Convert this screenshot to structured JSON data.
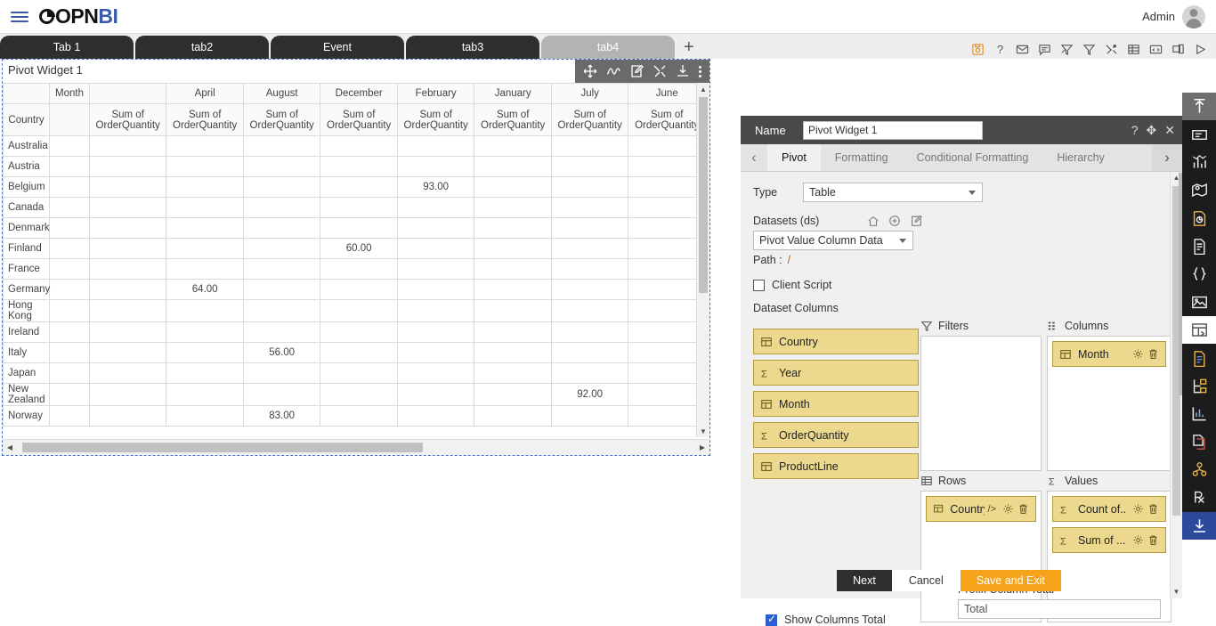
{
  "app": {
    "logo_opn": "OPN",
    "logo_bi": "BI",
    "user_label": "Admin"
  },
  "tabs": {
    "items": [
      {
        "label": "Tab 1",
        "active": false
      },
      {
        "label": "tab2",
        "active": false
      },
      {
        "label": "Event",
        "active": false
      },
      {
        "label": "tab3",
        "active": false
      },
      {
        "label": "tab4",
        "active": true
      }
    ],
    "add_label": "+"
  },
  "tabbar_icons": [
    {
      "name": "save-icon",
      "title": "Save"
    },
    {
      "name": "help-icon",
      "title": "Help"
    },
    {
      "name": "mail-icon",
      "title": "Mail"
    },
    {
      "name": "comment-icon",
      "title": "Comment"
    },
    {
      "name": "clear-filter-icon",
      "title": "Clear Filter"
    },
    {
      "name": "filter-icon",
      "title": "Filter"
    },
    {
      "name": "tools-icon",
      "title": "Tools"
    },
    {
      "name": "table-icon",
      "title": "Table"
    },
    {
      "name": "code-icon",
      "title": "Code"
    },
    {
      "name": "copy-icon",
      "title": "Copy"
    },
    {
      "name": "play-icon",
      "title": "Run"
    }
  ],
  "widget": {
    "title": "Pivot Widget 1",
    "tools": [
      {
        "name": "move-icon",
        "title": "Move"
      },
      {
        "name": "chart-icon",
        "title": "Chart"
      },
      {
        "name": "edit-icon",
        "title": "Edit"
      },
      {
        "name": "settings-tools-icon",
        "title": "Tools"
      },
      {
        "name": "download-icon",
        "title": "Download"
      },
      {
        "name": "more-options-icon",
        "title": "More"
      }
    ]
  },
  "chart_data": {
    "type": "table",
    "title": "Pivot Widget 1",
    "corner_row_label": "Country",
    "corner_col_label": "Month",
    "measure_label": "Sum of OrderQuantity",
    "categories": [
      "",
      "April",
      "August",
      "December",
      "February",
      "January",
      "July",
      "June"
    ],
    "row_labels": [
      "Australia",
      "Austria",
      "Belgium",
      "Canada",
      "Denmark",
      "Finland",
      "France",
      "Germany",
      "Hong Kong",
      "Ireland",
      "Italy",
      "Japan",
      "New Zealand",
      "Norway"
    ],
    "rows": [
      {
        "country": "Australia",
        "values": [
          "",
          "",
          "",
          "",
          "",
          "",
          "",
          ""
        ]
      },
      {
        "country": "Austria",
        "values": [
          "",
          "",
          "",
          "",
          "",
          "",
          "",
          ""
        ]
      },
      {
        "country": "Belgium",
        "values": [
          "",
          "",
          "",
          "",
          "93.00",
          "",
          "",
          ""
        ]
      },
      {
        "country": "Canada",
        "values": [
          "",
          "",
          "",
          "",
          "",
          "",
          "",
          ""
        ]
      },
      {
        "country": "Denmark",
        "values": [
          "",
          "",
          "",
          "",
          "",
          "",
          "",
          ""
        ]
      },
      {
        "country": "Finland",
        "values": [
          "",
          "",
          "",
          "60.00",
          "",
          "",
          "",
          ""
        ]
      },
      {
        "country": "France",
        "values": [
          "",
          "",
          "",
          "",
          "",
          "",
          "",
          ""
        ]
      },
      {
        "country": "Germany",
        "values": [
          "",
          "64.00",
          "",
          "",
          "",
          "",
          "",
          ""
        ]
      },
      {
        "country": "Hong Kong",
        "values": [
          "",
          "",
          "",
          "",
          "",
          "",
          "",
          ""
        ]
      },
      {
        "country": "Ireland",
        "values": [
          "",
          "",
          "",
          "",
          "",
          "",
          "",
          ""
        ]
      },
      {
        "country": "Italy",
        "values": [
          "",
          "",
          "56.00",
          "",
          "",
          "",
          "",
          ""
        ]
      },
      {
        "country": "Japan",
        "values": [
          "",
          "",
          "",
          "",
          "",
          "",
          "",
          ""
        ]
      },
      {
        "country": "New Zealand",
        "values": [
          "",
          "",
          "",
          "",
          "",
          "",
          "92.00",
          ""
        ]
      },
      {
        "country": "Norway",
        "values": [
          "",
          "",
          "83.00",
          "",
          "",
          "",
          "",
          ""
        ]
      }
    ]
  },
  "config": {
    "name_label": "Name",
    "name_value": "Pivot Widget 1",
    "header_icons": [
      {
        "name": "help-icon",
        "glyph": "?"
      },
      {
        "name": "move-icon",
        "glyph": "✥"
      },
      {
        "name": "close-icon",
        "glyph": "✕"
      }
    ],
    "tabs": [
      {
        "label": "Pivot",
        "active": true
      },
      {
        "label": "Formatting",
        "active": false
      },
      {
        "label": "Conditional Formatting",
        "active": false
      },
      {
        "label": "Hierarchy",
        "active": false
      }
    ],
    "type_label": "Type",
    "type_value": "Table",
    "datasets_label": "Datasets (ds)",
    "dataset_value": "Pivot Value Column Data",
    "path_label": "Path :",
    "path_value": "/",
    "client_script_label": "Client Script",
    "client_script_checked": false,
    "dataset_columns_label": "Dataset Columns",
    "dataset_columns": [
      {
        "label": "Country",
        "icon": "table-column-icon"
      },
      {
        "label": "Year",
        "icon": "sigma-icon"
      },
      {
        "label": "Month",
        "icon": "table-column-icon"
      },
      {
        "label": "OrderQuantity",
        "icon": "sigma-icon"
      },
      {
        "label": "ProductLine",
        "icon": "table-column-icon"
      }
    ],
    "zones": {
      "filters": {
        "label": "Filters",
        "icon": "filter-icon",
        "items": []
      },
      "columns": {
        "label": "Columns",
        "icon": "columns-icon",
        "items": [
          {
            "label": "Month",
            "icon": "table-column-icon",
            "code": "</>"
          }
        ]
      },
      "rows": {
        "label": "Rows",
        "icon": "rows-icon",
        "items": [
          {
            "label": "Country",
            "icon": "table-column-icon",
            "code": "/>"
          }
        ]
      },
      "values": {
        "label": "Values",
        "icon": "sigma-icon",
        "items": [
          {
            "label": "Count of..",
            "icon": "sigma-icon",
            "code": ""
          },
          {
            "label": "Sum of ...",
            "icon": "sigma-icon",
            "code": ""
          }
        ]
      }
    },
    "show_columns_total_label": "Show Columns Total",
    "show_columns_total_checked": true,
    "prefix_column_total_label": "Prefix Column Total",
    "prefix_column_total_value": "Total",
    "buttons": {
      "next": "Next",
      "cancel": "Cancel",
      "save_and_exit": "Save and Exit"
    }
  },
  "rail": [
    {
      "name": "collapse-up-icon",
      "state": "top-sel"
    },
    {
      "name": "text-box-icon",
      "state": ""
    },
    {
      "name": "bar-chart-icon",
      "state": ""
    },
    {
      "name": "map-icon",
      "state": ""
    },
    {
      "name": "report-icon",
      "state": ""
    },
    {
      "name": "document-icon",
      "state": ""
    },
    {
      "name": "braces-icon",
      "state": ""
    },
    {
      "name": "image-icon",
      "state": ""
    },
    {
      "name": "pivot-widget-icon",
      "state": "white-sel"
    },
    {
      "name": "page-icon",
      "state": ""
    },
    {
      "name": "tree-icon",
      "state": ""
    },
    {
      "name": "analytics-icon",
      "state": ""
    },
    {
      "name": "copy-page-icon",
      "state": ""
    },
    {
      "name": "group-icon",
      "state": ""
    },
    {
      "name": "rx-icon",
      "state": ""
    },
    {
      "name": "download-icon",
      "state": "blue-sel"
    }
  ],
  "colors": {
    "brand_blue": "#3a5ca8",
    "accent_orange": "#f5a31a",
    "pill_yellow": "#ecd98e",
    "tab_dark": "#2f2f2f"
  }
}
